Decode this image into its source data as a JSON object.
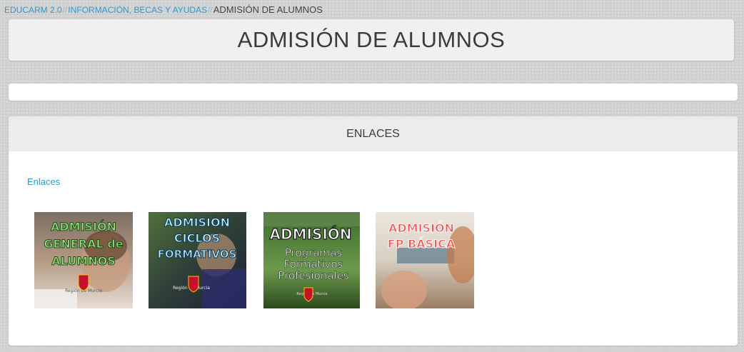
{
  "breadcrumb": {
    "items": [
      "EDUCARM 2.0",
      "INFORMACIÓN, BECAS Y AYUDAS"
    ],
    "separator": "//",
    "current": "ADMISIÓN DE ALUMNOS"
  },
  "page": {
    "title": "ADMISIÓN DE ALUMNOS"
  },
  "links_section": {
    "header": "ENLACES",
    "link_label": "Enlaces",
    "banners": [
      {
        "lines": [
          "ADMISIÓN",
          "GENERAL de",
          "ALUMNOS"
        ],
        "footer": "Región de Murcia"
      },
      {
        "lines": [
          "ADMISIÓN",
          "CICLOS",
          "FORMATIVOS"
        ],
        "footer": "Región de Murcia"
      },
      {
        "heading": "ADMISIÓN",
        "lines": [
          "Programas",
          "Formativos",
          "Profesionales"
        ],
        "footer": "Región de Murcia"
      },
      {
        "lines": [
          "ADMISIÓN",
          "FP BÁSICA"
        ]
      }
    ]
  },
  "colors": {
    "link": "#2b9ad3",
    "title": "#3b3b3b",
    "panel_header": "#ececec"
  }
}
